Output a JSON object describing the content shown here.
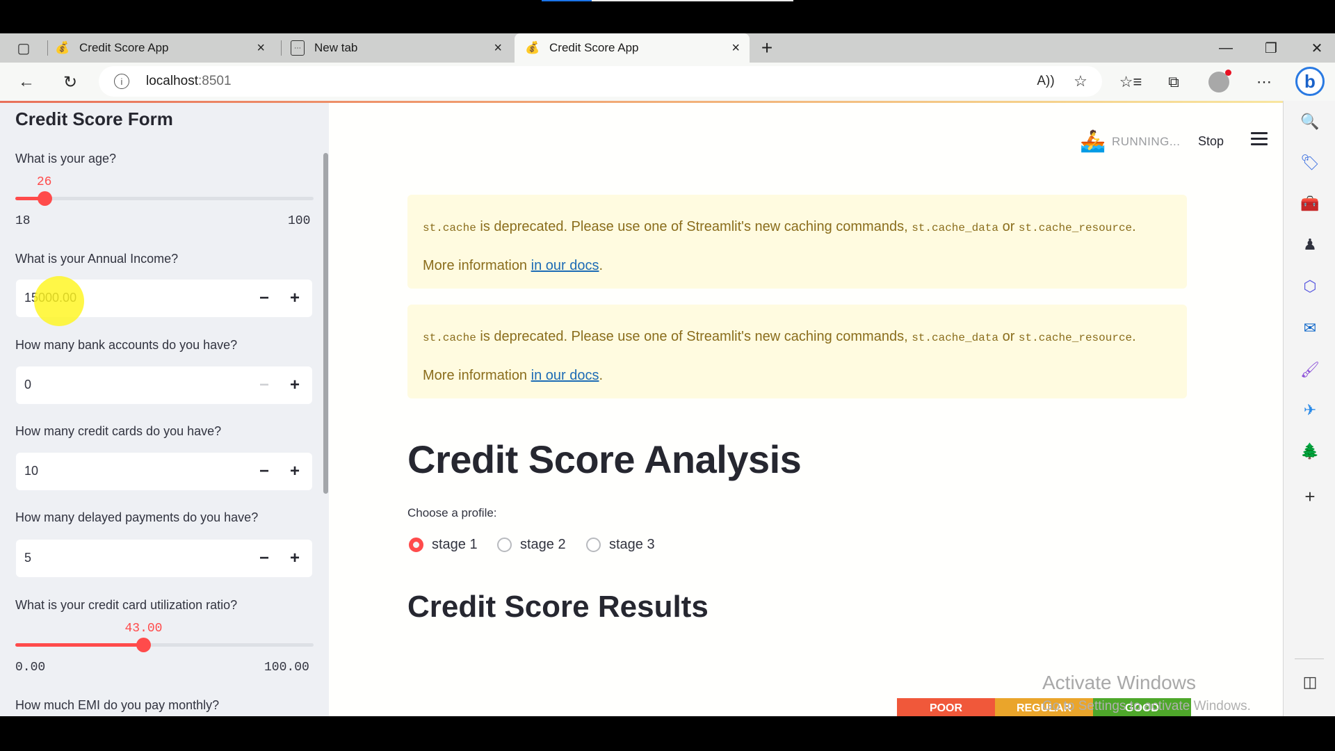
{
  "video_progress": {
    "fraction": 0.2
  },
  "browser": {
    "tabs": [
      {
        "title": "Credit Score App",
        "icon": "money-bag-icon",
        "active": false
      },
      {
        "title": "New tab",
        "icon": "new-tab-icon",
        "active": false
      },
      {
        "title": "Credit Score App",
        "icon": "money-bag-icon",
        "active": true
      }
    ],
    "new_tab_glyph": "+",
    "close_glyph": "×",
    "window": {
      "minimize": "—",
      "restore": "❐",
      "close": "✕"
    },
    "url_host": "localhost",
    "url_port": ":8501",
    "toolbar_icons": [
      "read-aloud-icon",
      "add-favorite-icon",
      "favorites-icon",
      "collections-icon",
      "profile-icon",
      "more-icon"
    ]
  },
  "sidebar": {
    "title": "Credit Score Form",
    "age": {
      "label": "What is your age?",
      "value": "26",
      "min": "18",
      "max": "100",
      "min_num": 18,
      "max_num": 100,
      "num": 26
    },
    "income": {
      "label": "What is your Annual Income?",
      "value": "15000.00"
    },
    "bank_accounts": {
      "label": "How many bank accounts do you have?",
      "value": "0"
    },
    "credit_cards": {
      "label": "How many credit cards do you have?",
      "value": "10"
    },
    "delayed_payments": {
      "label": "How many delayed payments do you have?",
      "value": "5"
    },
    "utilization": {
      "label": "What is your credit card utilization ratio?",
      "value": "43.00",
      "min": "0.00",
      "max": "100.00",
      "min_num": 0,
      "max_num": 100,
      "num": 43
    },
    "emi": {
      "label": "How much EMI do you pay monthly?"
    },
    "minus": "−",
    "plus": "+"
  },
  "status": {
    "running": "RUNNING...",
    "stop": "Stop"
  },
  "warnings": [
    {
      "code1": "st.cache",
      "text1": " is deprecated. Please use one of Streamlit's new caching commands, ",
      "code2": "st.cache_data",
      "or": " or ",
      "code3": "st.cache_resource",
      "end": ".",
      "more": "More information ",
      "link": "in our docs",
      "period": "."
    },
    {
      "code1": "st.cache",
      "text1": " is deprecated. Please use one of Streamlit's new caching commands, ",
      "code2": "st.cache_data",
      "or": " or ",
      "code3": "st.cache_resource",
      "end": ".",
      "more": "More information ",
      "link": "in our docs",
      "period": "."
    }
  ],
  "main": {
    "title": "Credit Score Analysis",
    "profile_label": "Choose a profile:",
    "profiles": [
      "stage 1",
      "stage 2",
      "stage 3"
    ],
    "selected_profile": "stage 1",
    "results_title": "Credit Score Results",
    "gauge": [
      {
        "label": "POOR",
        "color": "#f0583a"
      },
      {
        "label": "REGULAR",
        "color": "#eaa52b"
      },
      {
        "label": "GOOD",
        "color": "#4ea72a"
      }
    ]
  },
  "watermark": {
    "title": "Activate Windows",
    "subtitle": "Go to Settings to activate Windows."
  },
  "edge_sidebar": [
    "search-icon",
    "shopping-tag-icon",
    "tools-icon",
    "games-icon",
    "microsoft-365-icon",
    "outlook-icon",
    "designer-icon",
    "drop-icon",
    "tree-icon",
    "add-icon"
  ],
  "colors": {
    "accent": "#ff4b4b",
    "warning_bg": "#fffbe0",
    "warning_text": "#8a6d1c",
    "link": "#1c6bb5"
  }
}
